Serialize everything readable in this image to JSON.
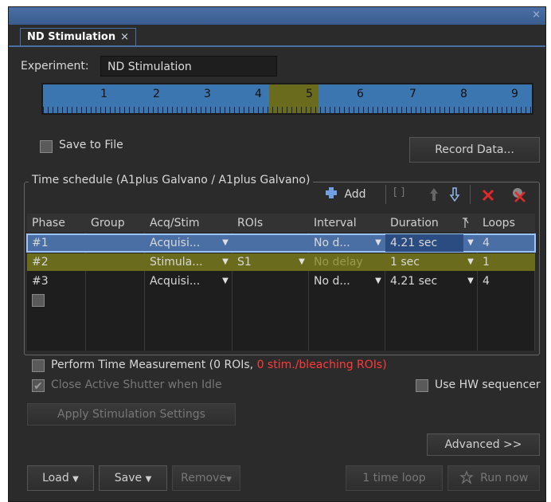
{
  "window": {
    "close": "×"
  },
  "tab": {
    "title": "ND Stimulation",
    "close": "×"
  },
  "experiment": {
    "label": "Experiment:",
    "value": "ND Stimulation"
  },
  "ruler": {
    "labels": [
      "1",
      "2",
      "3",
      "4",
      "5",
      "6",
      "7",
      "8",
      "9"
    ],
    "highlighted": "5"
  },
  "save_to_file": {
    "label": "Save to File",
    "checked": false
  },
  "record_data": {
    "label": "Record Data..."
  },
  "time_schedule": {
    "title": "Time schedule (A1plus Galvano / A1plus Galvano)",
    "add_label": "Add",
    "icons": [
      "bracket-icon",
      "arrow-up-icon",
      "arrow-down-icon",
      "delete-icon",
      "delete-all-icon"
    ]
  },
  "table": {
    "columns": [
      "Phase",
      "Group",
      "Acq/Stim",
      "ROIs",
      "Interval",
      "Duration",
      "Loops"
    ],
    "rows": [
      {
        "phase": "#1",
        "group": "",
        "acq": "Acquisi...",
        "rois": "",
        "interval": "No d...",
        "duration": "4.21 sec",
        "loops": "4",
        "state": "selected"
      },
      {
        "phase": "#2",
        "group": "",
        "acq": "Stimula...",
        "rois": "S1",
        "interval": "No delay",
        "duration": "1 sec",
        "loops": "1",
        "state": "stim"
      },
      {
        "phase": "#3",
        "group": "",
        "acq": "Acquisi...",
        "rois": "",
        "interval": "No d...",
        "duration": "4.21 sec",
        "loops": "4",
        "state": "normal"
      }
    ]
  },
  "perform": {
    "label_main": "Perform Time Measurement (0 ROIs, ",
    "label_red": "0 stim./bleaching ROIs)"
  },
  "close_shutter": {
    "label": "Close Active Shutter when Idle",
    "checked": true
  },
  "hw_sequencer": {
    "label": "Use HW sequencer",
    "checked": false
  },
  "apply_stim": {
    "label": "Apply Stimulation Settings"
  },
  "advanced": {
    "label": "Advanced >>"
  },
  "bottom": {
    "load": "Load",
    "save": "Save",
    "remove": "Remove",
    "loop": "1 time loop",
    "run": "Run now"
  },
  "colors": {
    "accent": "#4a6fa5",
    "ruler": "#3c76b0",
    "highlight": "#6b6b1e",
    "selected_row": "#4a6fa5",
    "stim_row": "#6b6b1e",
    "warning": "#ff3a3a"
  }
}
